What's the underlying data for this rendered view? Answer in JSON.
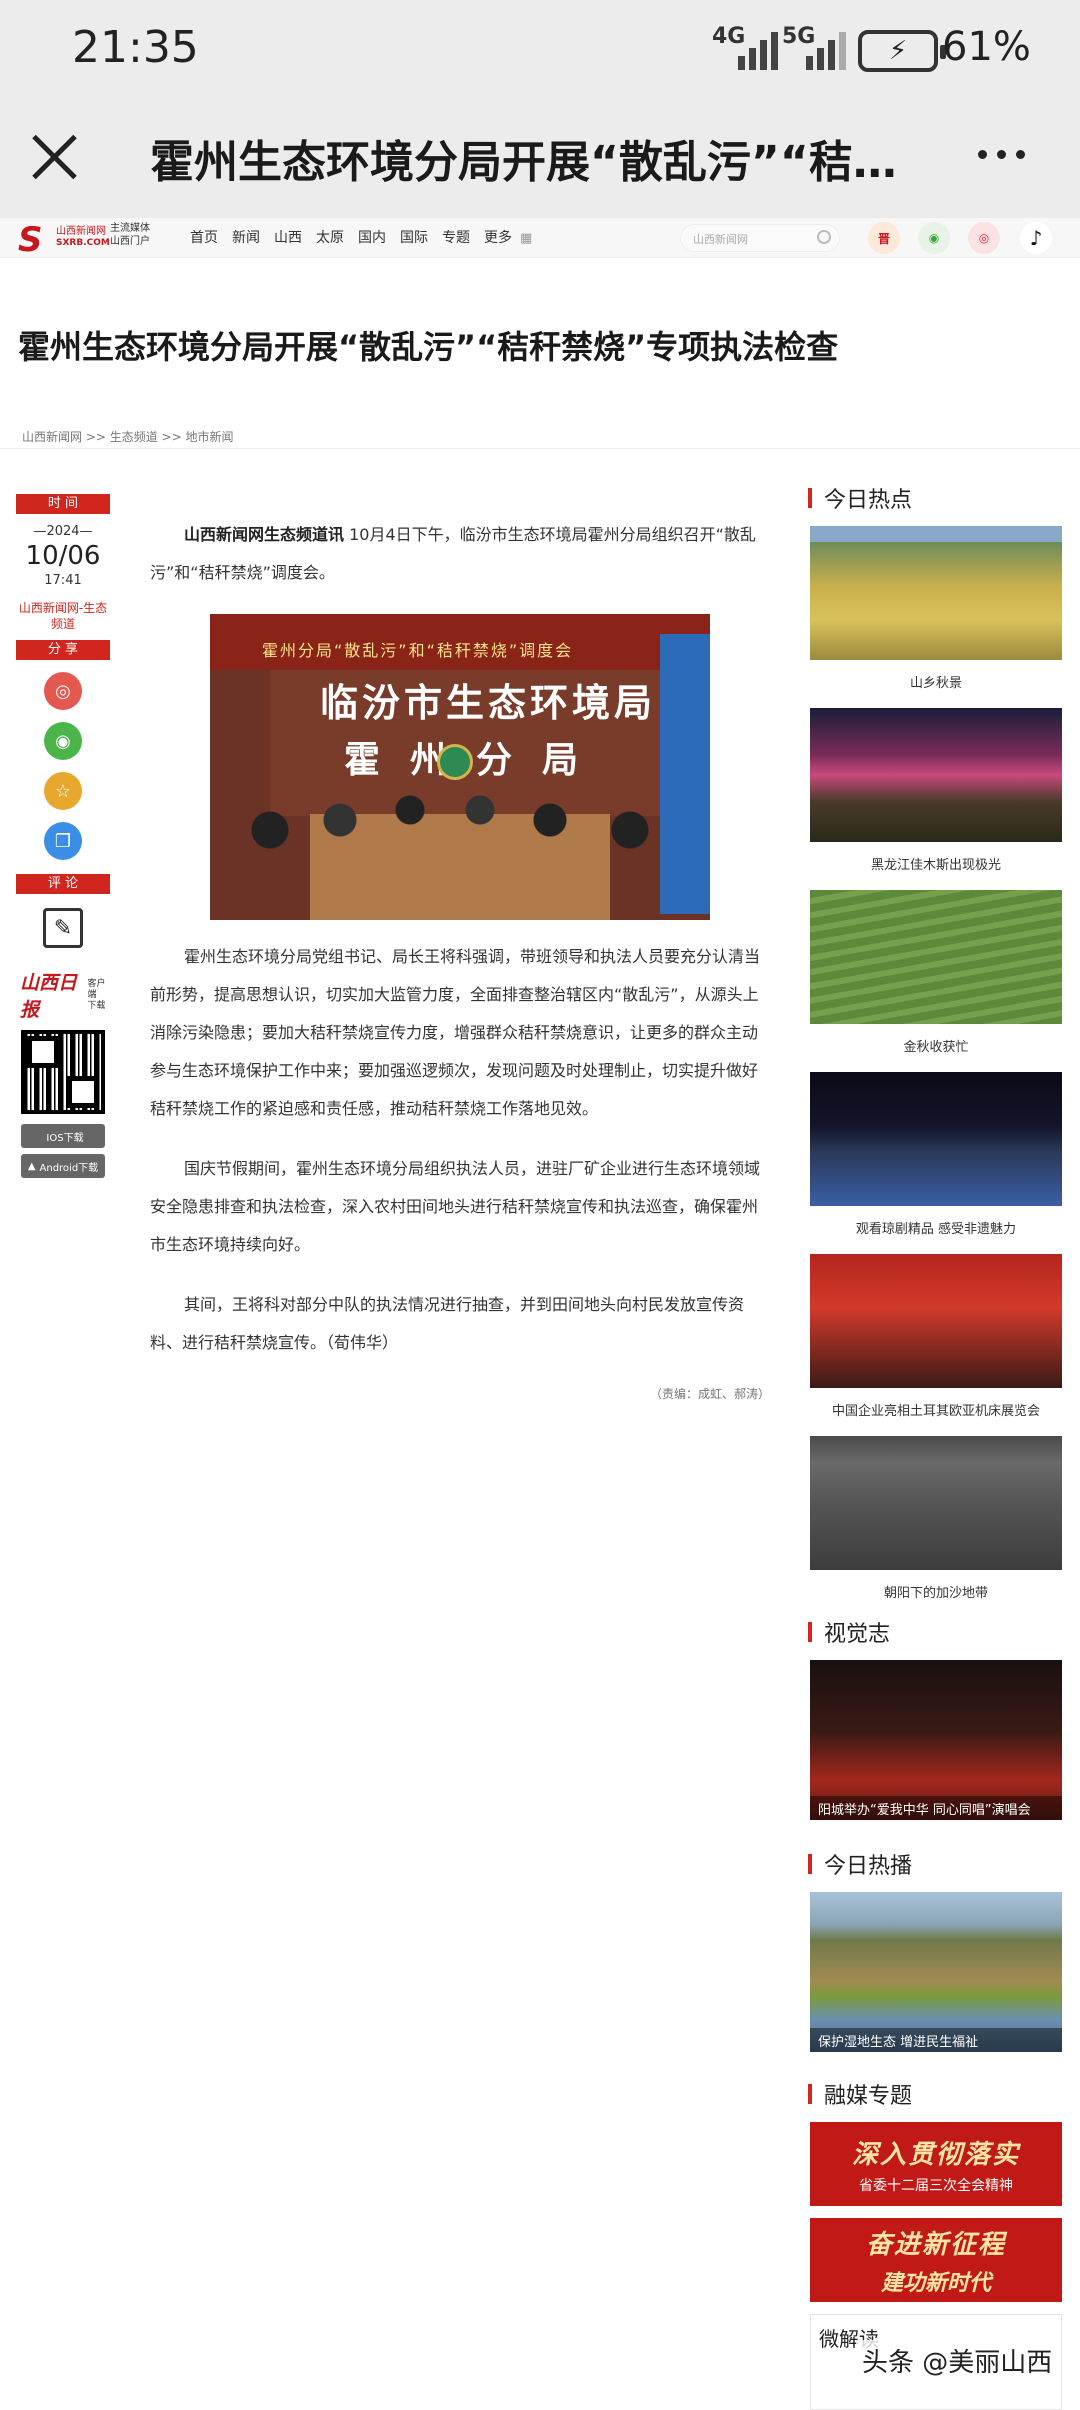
{
  "status_bar": {
    "time": "21:35",
    "signal_1": "4G",
    "signal_2": "5G",
    "battery_percent": "61%"
  },
  "title_bar": {
    "title": "霍州生态环境分局开展“散乱污”“秸秆…"
  },
  "site_nav": {
    "logo_mark": "S",
    "logo_name": "山西新闻网",
    "logo_domain": "SXRB.COM",
    "slogan_line1": "主流媒体",
    "slogan_line2": "山西门户",
    "links": [
      "首页",
      "新闻",
      "山西",
      "太原",
      "国内",
      "国际",
      "专题",
      "更多"
    ],
    "search_placeholder": "山西新闻网"
  },
  "article": {
    "title": "霍州生态环境分局开展“散乱污”“秸秆禁烧”专项执法检查",
    "breadcrumb": "山西新闻网 >> 生态频道 >> 地市新闻",
    "left": {
      "time_label": "时 间",
      "year": "—2024—",
      "date": "10/06",
      "clock": "17:41",
      "source": "山西新闻网-生态频道",
      "share_label": "分 享",
      "comment_label": "评 论",
      "app_brand": "山西日报",
      "app_tag_1": "客户端",
      "app_tag_2": "下载",
      "ios_label": "IOS下载",
      "android_label": "Android下载"
    },
    "lead_bold": "山西新闻网生态频道讯",
    "lead_text": " 10月4日下午，临汾市生态环境局霍州分局组织召开“散乱污”和“秸秆禁烧”调度会。",
    "photo": {
      "banner": "霍州分局“散乱污”和“秸秆禁烧”调度会",
      "wall_line1": "临汾市生态环境局",
      "wall_line2": "霍州分局"
    },
    "para2": "霍州生态环境分局党组书记、局长王将科强调，带班领导和执法人员要充分认清当前形势，提高思想认识，切实加大监管力度，全面排查整治辖区内“散乱污”，从源头上消除污染隐患；要加大秸秆禁烧宣传力度，增强群众秸秆禁烧意识，让更多的群众主动参与生态环境保护工作中来；要加强巡逻频次，发现问题及时处理制止，切实提升做好秸秆禁烧工作的紧迫感和责任感，推动秸秆禁烧工作落地见效。",
    "para3": "国庆节假期间，霍州生态环境分局组织执法人员，进驻厂矿企业进行生态环境领域安全隐患排查和执法检查，深入农村田间地头进行秸秆禁烧宣传和执法巡查，确保霍州市生态环境持续向好。",
    "para4": "其间，王将科对部分中队的执法情况进行抽查，并到田间地头向村民发放宣传资料、进行秸秆禁烧宣传。（荀伟华）",
    "editor": "（责编：成虹、郝涛）"
  },
  "sidebar": {
    "hot_title": "今日热点",
    "hot_items": [
      "山乡秋景",
      "黑龙江佳木斯出现极光",
      "金秋收获忙",
      "观看琼剧精品 感受非遗魅力",
      "中国企业亮相土耳其欧亚机床展览会",
      "朝阳下的加沙地带"
    ],
    "visual_title": "视觉志",
    "visual_caption": "阳城举办“爱我中华 同心同唱”演唱会",
    "broadcast_title": "今日热播",
    "broadcast_caption": "保护湿地生态 增进民生福祉",
    "media_title": "融媒专题",
    "topic1_main": "深入贯彻落实",
    "topic1_sub": "省委十二届三次全会精神",
    "topic2_main": "奋进新征程",
    "topic2_sub": "建功新时代",
    "weidu_title": "微解读"
  },
  "watermark": "头条 @美丽山西",
  "colors": {
    "accent_red": "#d0261e",
    "status_bg": "#ececec"
  }
}
